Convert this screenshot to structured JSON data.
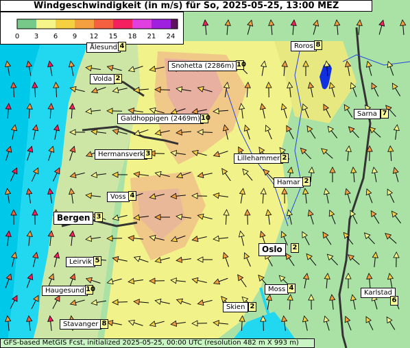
{
  "title": "Windgeschwindigkeit (in m/s) für So, 2025-05-25, 13:00 MEZ",
  "footer": "GFS-based MetGIS Fcst, initialized 2025-05-25, 00:00 UTC  (resolution 482 m X 993 m)",
  "legend": {
    "ticks": [
      "0",
      "3",
      "6",
      "9",
      "12",
      "15",
      "18",
      "21",
      "24"
    ],
    "colors": [
      "#77c98a",
      "#f5f58a",
      "#f5d040",
      "#f5a040",
      "#f56040",
      "#f52060",
      "#e040e0",
      "#a020e0",
      "#601060"
    ]
  },
  "stations": [
    {
      "name": "Ålesund",
      "value": "4"
    },
    {
      "name": "Roros",
      "value": "8"
    },
    {
      "name": "Snohetta (2286m)",
      "value": "10"
    },
    {
      "name": "Volda",
      "value": "2"
    },
    {
      "name": "Sarna",
      "value": "7"
    },
    {
      "name": "Galdhoppigen (2469m)",
      "value": "10"
    },
    {
      "name": "Hermansverk",
      "value": "3"
    },
    {
      "name": "Lillehammer",
      "value": "2"
    },
    {
      "name": "Hamar",
      "value": "2"
    },
    {
      "name": "Voss",
      "value": "4"
    },
    {
      "name": "Bergen",
      "value": "3"
    },
    {
      "name": "Oslo",
      "value": "2"
    },
    {
      "name": "Leirvik",
      "value": "5"
    },
    {
      "name": "Moss",
      "value": "4"
    },
    {
      "name": "Haugesund",
      "value": "10"
    },
    {
      "name": "Karlstad",
      "value": "6"
    },
    {
      "name": "Skien",
      "value": "2"
    },
    {
      "name": "Stavanger",
      "value": "8"
    }
  ]
}
